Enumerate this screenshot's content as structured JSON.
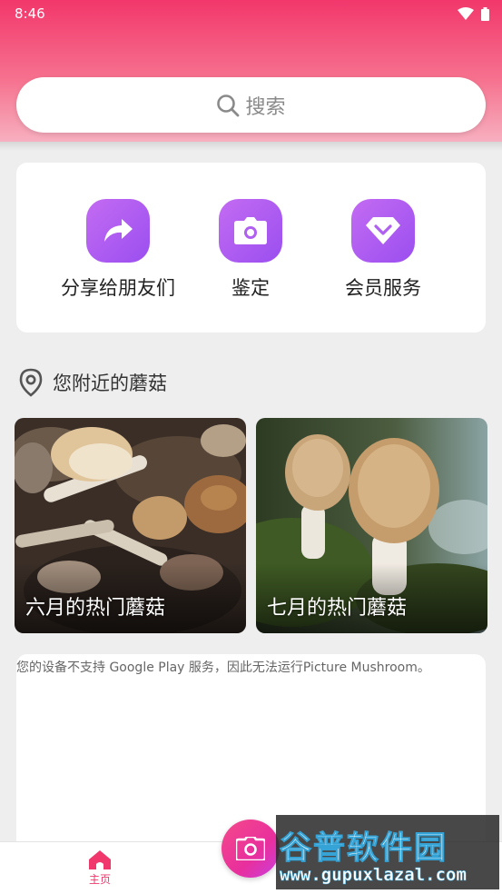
{
  "status_bar": {
    "time": "8:46"
  },
  "search": {
    "label": "搜索"
  },
  "actions": [
    {
      "label": "分享给朋友们",
      "icon": "share-arrow-icon"
    },
    {
      "label": "鉴定",
      "icon": "camera-icon"
    },
    {
      "label": "会员服务",
      "icon": "diamond-icon"
    }
  ],
  "nearby": {
    "title": "您附近的蘑菇",
    "icon": "location-pin-icon"
  },
  "cards": [
    {
      "label": "六月的热门蘑菇"
    },
    {
      "label": "七月的热门蘑菇"
    }
  ],
  "notice": {
    "text": "您的设备不支持 Google Play 服务，因此无法运行Picture Mushroom。"
  },
  "bottom_nav": {
    "home_label": "主页"
  },
  "watermark": {
    "title": "谷普软件园",
    "url": "www.gupuxlazal.com"
  },
  "colors": {
    "accent": "#f1386d",
    "purple": "#a657f1"
  }
}
